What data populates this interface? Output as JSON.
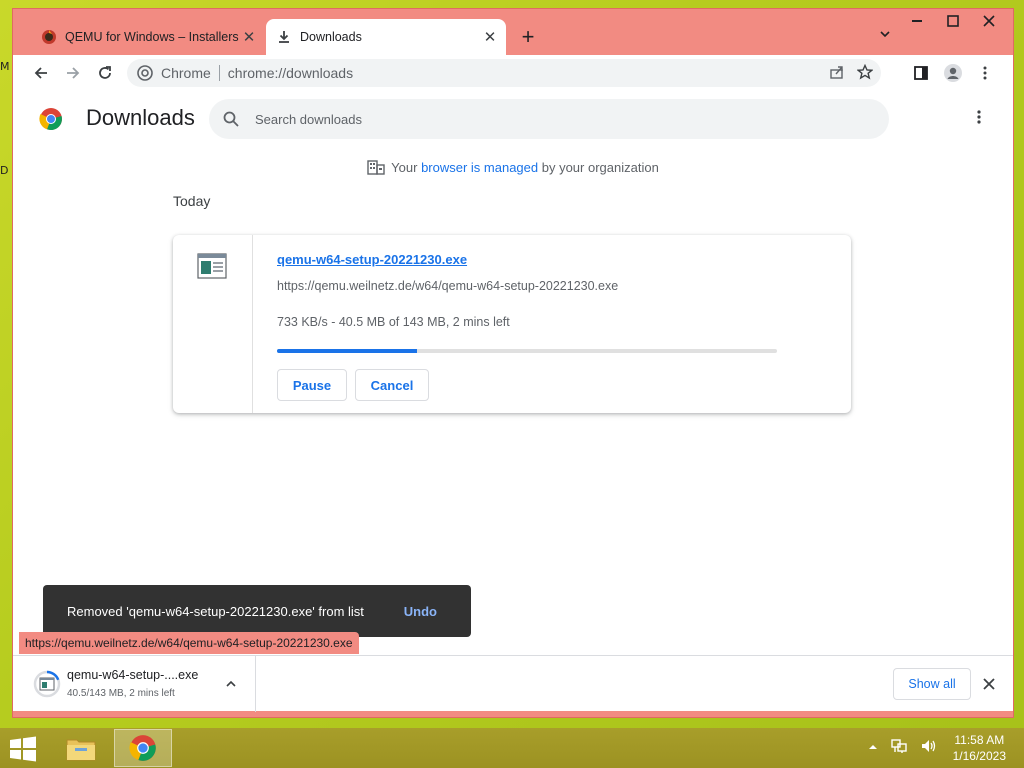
{
  "desktop": {
    "edge_letters": [
      "M",
      "D"
    ]
  },
  "browser": {
    "tabs": [
      {
        "title": "QEMU for Windows – Installers (",
        "active": false,
        "favicon": "qemu-icon"
      },
      {
        "title": "Downloads",
        "active": true,
        "favicon": "download-icon"
      }
    ],
    "window_controls": {
      "minimize": "▬",
      "maximize": "☐",
      "close": "✕"
    },
    "omnibox": {
      "chip": "Chrome",
      "url": "chrome://downloads"
    }
  },
  "downloads_page": {
    "title": "Downloads",
    "search_placeholder": "Search downloads",
    "managed": {
      "prefix": "Your ",
      "link": "browser is managed",
      "suffix": " by your organization"
    },
    "date_header": "Today",
    "item": {
      "filename": "qemu-w64-setup-20221230.exe",
      "url": "https://qemu.weilnetz.de/w64/qemu-w64-setup-20221230.exe",
      "status": "733 KB/s - 40.5 MB of 143 MB, 2 mins left",
      "progress_fraction": 0.28,
      "pause_label": "Pause",
      "cancel_label": "Cancel"
    },
    "toast": {
      "message": "Removed 'qemu-w64-setup-20221230.exe' from list",
      "action": "Undo"
    },
    "status_url": "https://qemu.weilnetz.de/w64/qemu-w64-setup-20221230.exe"
  },
  "shelf": {
    "item_name": "qemu-w64-setup-....exe",
    "item_status": "40.5/143 MB, 2 mins left",
    "show_all": "Show all"
  },
  "taskbar": {
    "time": "11:58 AM",
    "date": "1/16/2023"
  },
  "colors": {
    "frame": "#f28b82",
    "accent": "#1a73e8",
    "taskbar": "#9c9222"
  }
}
